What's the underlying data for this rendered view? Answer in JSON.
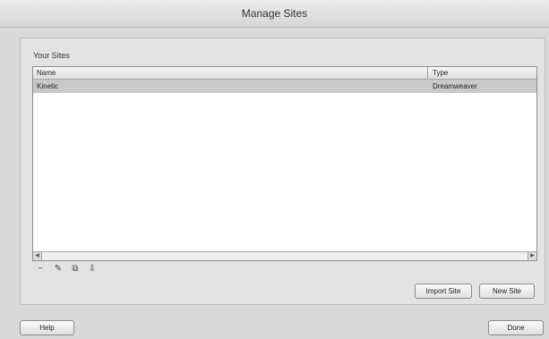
{
  "window": {
    "title": "Manage Sites"
  },
  "sites_panel": {
    "label": "Your Sites",
    "columns": {
      "name": "Name",
      "type": "Type"
    },
    "rows": [
      {
        "name": "Kinetic",
        "type": "Dreamweaver"
      }
    ],
    "scroll_left_glyph": "◀",
    "scroll_right_glyph": "▶"
  },
  "toolbar": {
    "icons": [
      "remove-icon",
      "edit-icon",
      "duplicate-icon",
      "export-icon"
    ],
    "glyphs": {
      "remove": "−",
      "edit": "✎",
      "duplicate": "⧉",
      "export": "⇩"
    }
  },
  "actions": {
    "import": "Import Site",
    "new": "New Site"
  },
  "footer": {
    "help": "Help",
    "done": "Done"
  }
}
